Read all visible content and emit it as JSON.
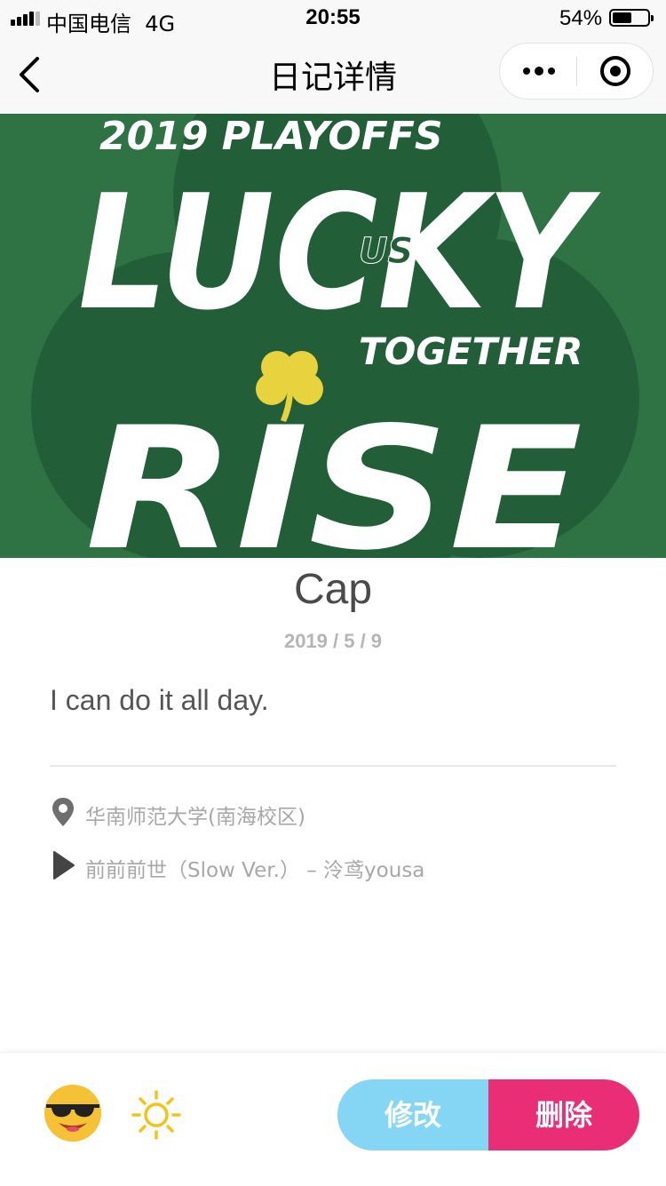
{
  "status_bar": {
    "carrier": "中国电信",
    "network": "4G",
    "time": "20:55",
    "battery_percent": "54%",
    "battery_level": 0.54
  },
  "nav": {
    "title": "日记详情",
    "back_icon": "chevron-left-icon",
    "more_icon": "more-dots-icon",
    "close_icon": "target-close-icon"
  },
  "cover": {
    "lines": [
      "2019 PLAYOFFS",
      "LUCKY",
      "US",
      "TOGETHER",
      "RISE"
    ],
    "colors": {
      "background": "#2f7244",
      "clover": "#225f39",
      "shamrock": "#e8d33f",
      "text": "#ffffff"
    }
  },
  "entry": {
    "title": "Cap",
    "date": "2019 / 5 / 9",
    "body": "I can do it all day."
  },
  "meta": {
    "location": "华南师范大学(南海校区)",
    "location_icon": "location-pin-icon",
    "music": "前前前世（Slow Ver.） – 泠鸢yousa",
    "music_icon": "play-icon"
  },
  "bottom": {
    "mood_icon": "sunglasses-emoji-icon",
    "weather_icon": "sun-icon",
    "edit_label": "修改",
    "delete_label": "删除",
    "colors": {
      "edit": "#84d6f4",
      "delete": "#ea2e76",
      "sun": "#f2c417"
    }
  }
}
